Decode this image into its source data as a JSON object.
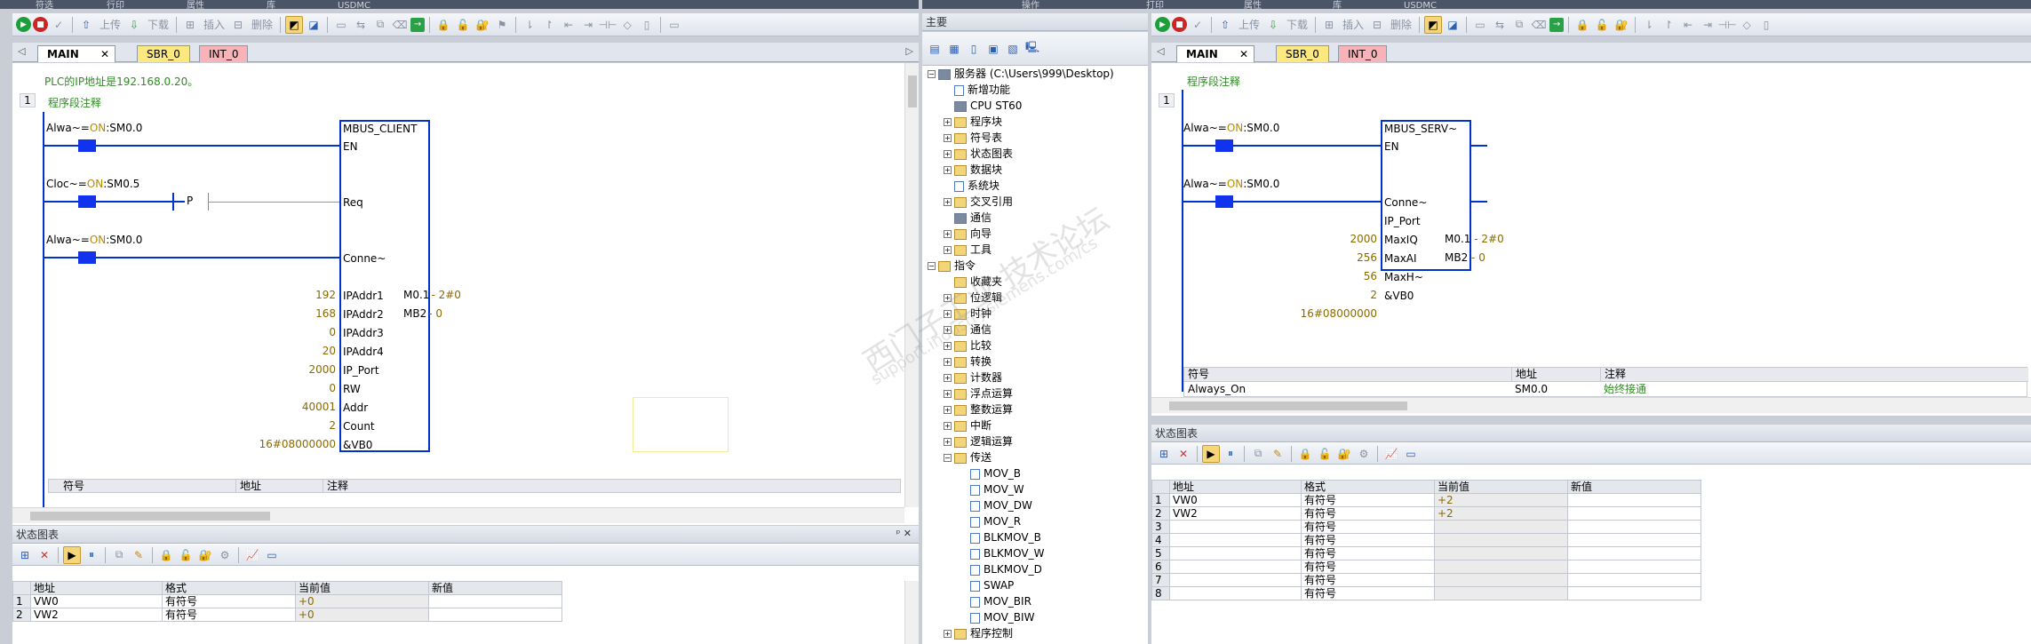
{
  "top_tabs_left": [
    "符选",
    "行印",
    "属性",
    "库",
    "USDMC"
  ],
  "top_tabs_right": [
    "操作",
    "打印",
    "属性",
    "库",
    "USDMC"
  ],
  "toolbar": {
    "upload": "上传",
    "download": "下载",
    "insert": "插入",
    "delete": "删除"
  },
  "editor_tabs": {
    "main": "MAIN",
    "sbr": "SBR_0",
    "int": "INT_0"
  },
  "left_editor": {
    "network_comment": "PLC的IP地址是192.168.0.20。",
    "rung_number": "1",
    "rung_comment": "程序段注释",
    "contacts": [
      {
        "prefix": "Alwa~=",
        "state": "ON",
        "addr": ":SM0.0"
      },
      {
        "prefix": "Cloc~=",
        "state": "ON",
        "addr": ":SM0.5"
      },
      {
        "prefix": "Alwa~=",
        "state": "ON",
        "addr": ":SM0.0"
      }
    ],
    "p_label": "P",
    "block_title": "MBUS_CLIENT",
    "block_pins": [
      "EN",
      "Req",
      "Conne~",
      "IPAddr1",
      "IPAddr2",
      "IPAddr3",
      "IPAddr4",
      "IP_Port",
      "RW",
      "Addr",
      "Count",
      "&VB0"
    ],
    "block_inputs": [
      "192",
      "168",
      "0",
      "20",
      "2000",
      "0",
      "40001",
      "2",
      "16#08000000"
    ],
    "block_outputs": [
      {
        "pin": "M0.1",
        "val": "2#0"
      },
      {
        "pin": "MB2",
        "val": "0"
      }
    ],
    "symbol_headers": [
      "符号",
      "地址",
      "注释"
    ]
  },
  "left_status": {
    "title": "状态图表",
    "headers": [
      "地址",
      "格式",
      "当前值",
      "新值"
    ],
    "rows": [
      {
        "n": "1",
        "addr": "VW0",
        "fmt": "有符号",
        "cur": "+0",
        "new": ""
      },
      {
        "n": "2",
        "addr": "VW2",
        "fmt": "有符号",
        "cur": "+0",
        "new": ""
      }
    ]
  },
  "tree": {
    "title": "主要",
    "items": [
      {
        "exp": "−",
        "indent": 0,
        "icon": "cpu",
        "label": "服务器 (C:\\Users\\999\\Desktop)"
      },
      {
        "exp": "",
        "indent": 1,
        "icon": "doc",
        "label": "新增功能"
      },
      {
        "exp": "",
        "indent": 1,
        "icon": "cpu",
        "label": "CPU ST60"
      },
      {
        "exp": "+",
        "indent": 1,
        "icon": "fold",
        "label": "程序块"
      },
      {
        "exp": "+",
        "indent": 1,
        "icon": "fold",
        "label": "符号表"
      },
      {
        "exp": "+",
        "indent": 1,
        "icon": "fold",
        "label": "状态图表"
      },
      {
        "exp": "+",
        "indent": 1,
        "icon": "fold",
        "label": "数据块"
      },
      {
        "exp": "",
        "indent": 1,
        "icon": "doc",
        "label": "系统块"
      },
      {
        "exp": "+",
        "indent": 1,
        "icon": "fold",
        "label": "交叉引用"
      },
      {
        "exp": "",
        "indent": 1,
        "icon": "cpu",
        "label": "通信"
      },
      {
        "exp": "+",
        "indent": 1,
        "icon": "fold",
        "label": "向导"
      },
      {
        "exp": "+",
        "indent": 1,
        "icon": "fold",
        "label": "工具"
      },
      {
        "exp": "−",
        "indent": 0,
        "icon": "fold",
        "label": "指令"
      },
      {
        "exp": "",
        "indent": 1,
        "icon": "fold",
        "label": "收藏夹"
      },
      {
        "exp": "+",
        "indent": 1,
        "icon": "fold",
        "label": "位逻辑"
      },
      {
        "exp": "+",
        "indent": 1,
        "icon": "fold",
        "label": "时钟"
      },
      {
        "exp": "+",
        "indent": 1,
        "icon": "fold",
        "label": "通信"
      },
      {
        "exp": "+",
        "indent": 1,
        "icon": "fold",
        "label": "比较"
      },
      {
        "exp": "+",
        "indent": 1,
        "icon": "fold",
        "label": "转换"
      },
      {
        "exp": "+",
        "indent": 1,
        "icon": "fold",
        "label": "计数器"
      },
      {
        "exp": "+",
        "indent": 1,
        "icon": "fold",
        "label": "浮点运算"
      },
      {
        "exp": "+",
        "indent": 1,
        "icon": "fold",
        "label": "整数运算"
      },
      {
        "exp": "+",
        "indent": 1,
        "icon": "fold",
        "label": "中断"
      },
      {
        "exp": "+",
        "indent": 1,
        "icon": "fold",
        "label": "逻辑运算"
      },
      {
        "exp": "−",
        "indent": 1,
        "icon": "fold",
        "label": "传送"
      },
      {
        "exp": "",
        "indent": 2,
        "icon": "doc",
        "label": "MOV_B"
      },
      {
        "exp": "",
        "indent": 2,
        "icon": "doc",
        "label": "MOV_W"
      },
      {
        "exp": "",
        "indent": 2,
        "icon": "doc",
        "label": "MOV_DW"
      },
      {
        "exp": "",
        "indent": 2,
        "icon": "doc",
        "label": "MOV_R"
      },
      {
        "exp": "",
        "indent": 2,
        "icon": "doc",
        "label": "BLKMOV_B"
      },
      {
        "exp": "",
        "indent": 2,
        "icon": "doc",
        "label": "BLKMOV_W"
      },
      {
        "exp": "",
        "indent": 2,
        "icon": "doc",
        "label": "BLKMOV_D"
      },
      {
        "exp": "",
        "indent": 2,
        "icon": "doc",
        "label": "SWAP"
      },
      {
        "exp": "",
        "indent": 2,
        "icon": "doc",
        "label": "MOV_BIR"
      },
      {
        "exp": "",
        "indent": 2,
        "icon": "doc",
        "label": "MOV_BIW"
      },
      {
        "exp": "+",
        "indent": 1,
        "icon": "fold",
        "label": "程序控制"
      }
    ]
  },
  "right_editor": {
    "rung_number": "1",
    "rung_comment": "程序段注释",
    "contacts": [
      {
        "prefix": "Alwa~=",
        "state": "ON",
        "addr": ":SM0.0"
      },
      {
        "prefix": "Alwa~=",
        "state": "ON",
        "addr": ":SM0.0"
      }
    ],
    "block_title": "MBUS_SERV~",
    "block_pins": [
      "EN",
      "Conne~",
      "IP_Port",
      "MaxIQ",
      "MaxAI",
      "MaxH~",
      "&VB0"
    ],
    "block_inputs": [
      "2000",
      "256",
      "56",
      "2",
      "16#08000000"
    ],
    "block_outputs": [
      {
        "pin": "M0.1",
        "val": "2#0"
      },
      {
        "pin": "MB2",
        "val": "0"
      }
    ],
    "symbol_headers": [
      "符号",
      "地址",
      "注释"
    ],
    "symbol_row": {
      "sym": "Always_On",
      "addr": "SM0.0",
      "cmt": "始终接通"
    }
  },
  "right_status": {
    "title": "状态图表",
    "headers": [
      "地址",
      "格式",
      "当前值",
      "新值"
    ],
    "rows": [
      {
        "n": "1",
        "addr": "VW0",
        "fmt": "有符号",
        "cur": "+2",
        "new": ""
      },
      {
        "n": "2",
        "addr": "VW2",
        "fmt": "有符号",
        "cur": "+2",
        "new": ""
      },
      {
        "n": "3",
        "addr": "",
        "fmt": "有符号",
        "cur": "",
        "new": ""
      },
      {
        "n": "4",
        "addr": "",
        "fmt": "有符号",
        "cur": "",
        "new": ""
      },
      {
        "n": "5",
        "addr": "",
        "fmt": "有符号",
        "cur": "",
        "new": ""
      },
      {
        "n": "6",
        "addr": "",
        "fmt": "有符号",
        "cur": "",
        "new": ""
      },
      {
        "n": "7",
        "addr": "",
        "fmt": "有符号",
        "cur": "",
        "new": ""
      },
      {
        "n": "8",
        "addr": "",
        "fmt": "有符号",
        "cur": "",
        "new": ""
      }
    ]
  },
  "watermark": {
    "line1": "西门子工业  技术论坛",
    "line2": "support.industry.siemens.com/cs"
  },
  "colors": {
    "ladder_blue": "#0033cc",
    "comment_green": "#2e8b22",
    "on_color": "#b88a00"
  }
}
